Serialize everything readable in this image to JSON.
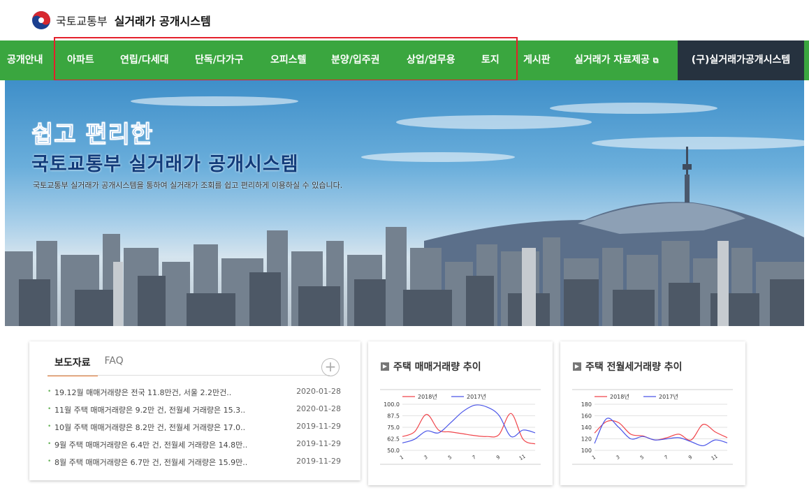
{
  "header": {
    "org": "국토교통부",
    "system": "실거래가 공개시스템"
  },
  "nav": {
    "items": [
      {
        "label": "공개안내"
      },
      {
        "label": "아파트"
      },
      {
        "label": "연립/다세대"
      },
      {
        "label": "단독/다가구"
      },
      {
        "label": "오피스텔"
      },
      {
        "label": "분양/입주권"
      },
      {
        "label": "상업/업무용"
      },
      {
        "label": "토지"
      },
      {
        "label": "게시판"
      },
      {
        "label": "실거래가 자료제공"
      }
    ],
    "old_system": "(구)실거래가공개시스템",
    "highlight_color": "#e4202b",
    "bg_color": "#3aa63f"
  },
  "hero": {
    "line1": "쉽고 편리한",
    "line2": "국토교통부 실거래가 공개시스템",
    "desc": "국토교통부 실거래가 공개시스템을 통하여 실거래가 조회를 쉽고 편리하게 이용하실 수 있습니다."
  },
  "news": {
    "tabs": [
      "보도자료",
      "FAQ"
    ],
    "more_icon": "plus-circle-icon",
    "items": [
      {
        "title": "19.12월 매매거래량은 전국 11.8만건, 서울 2.2만건..",
        "date": "2020-01-28"
      },
      {
        "title": "11월 주택 매매거래량은 9.2만 건, 전월세 거래량은 15.3..",
        "date": "2020-01-28"
      },
      {
        "title": "10월 주택 매매거래량은 8.2만 건, 전월세 거래량은 17.0..",
        "date": "2019-11-29"
      },
      {
        "title": "9월 주택 매매거래량은 6.4만 건, 전월세 거래량은 14.8만..",
        "date": "2019-11-29"
      },
      {
        "title": "8월 주택 매매거래량은 6.7만 건, 전월세 거래량은 15.9만..",
        "date": "2019-11-29"
      }
    ]
  },
  "chart_data": [
    {
      "type": "line",
      "title": "주택 매매거래량 추이",
      "x": [
        1,
        2,
        3,
        4,
        5,
        6,
        7,
        8,
        9,
        10,
        11,
        12
      ],
      "x_ticks": [
        "1",
        "3",
        "5",
        "7",
        "9",
        "11"
      ],
      "y_ticks": [
        "100.0",
        "87.5",
        "75.0",
        "62.5",
        "50.0"
      ],
      "ylim": [
        50,
        100
      ],
      "series": [
        {
          "name": "2018년",
          "color": "#f0454b",
          "values": [
            65,
            70,
            89,
            72,
            70,
            68,
            66,
            65,
            67,
            90,
            62,
            57
          ]
        },
        {
          "name": "2017년",
          "color": "#4a55e8",
          "values": [
            58,
            62,
            71,
            69,
            80,
            92,
            99,
            97,
            88,
            65,
            72,
            69
          ]
        }
      ]
    },
    {
      "type": "line",
      "title": "주택 전월세거래량 추이",
      "x": [
        1,
        2,
        3,
        4,
        5,
        6,
        7,
        8,
        9,
        10,
        11,
        12
      ],
      "x_ticks": [
        "1",
        "3",
        "5",
        "7",
        "9",
        "11"
      ],
      "y_ticks": [
        "180",
        "160",
        "140",
        "120",
        "100"
      ],
      "ylim": [
        100,
        180
      ],
      "series": [
        {
          "name": "2018년",
          "color": "#f0454b",
          "values": [
            130,
            150,
            148,
            128,
            125,
            118,
            122,
            128,
            118,
            145,
            132,
            122
          ]
        },
        {
          "name": "2017년",
          "color": "#4a55e8",
          "values": [
            112,
            155,
            140,
            120,
            124,
            118,
            120,
            122,
            115,
            108,
            118,
            113
          ]
        }
      ]
    }
  ]
}
